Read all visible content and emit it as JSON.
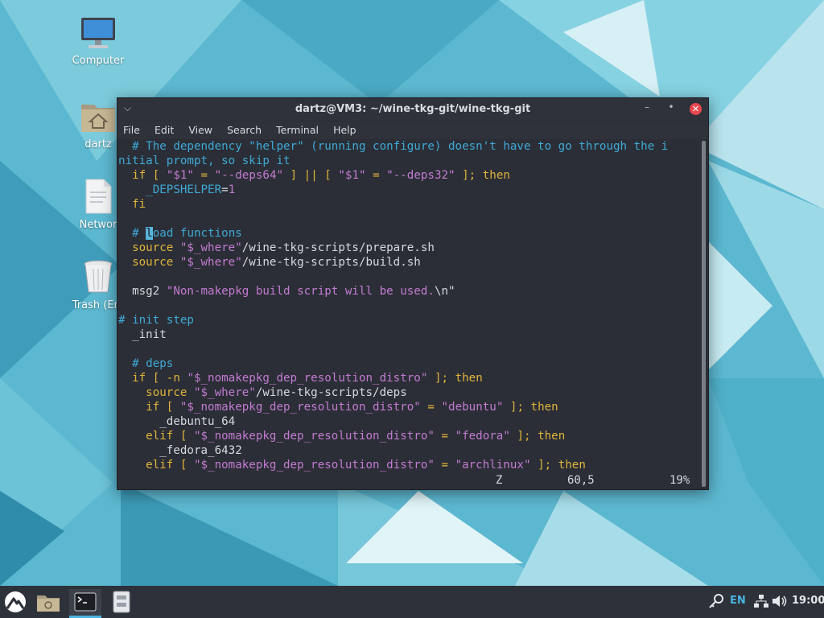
{
  "desktop_icons": [
    {
      "name": "Computer"
    },
    {
      "name": "dartz"
    },
    {
      "name": "Networ"
    },
    {
      "name": "Trash (Em"
    }
  ],
  "window": {
    "title": "dartz@VM3: ~/wine-tkg-git/wine-tkg-git",
    "menu_icon": "chevron-down-icon",
    "menu": [
      "File",
      "Edit",
      "View",
      "Search",
      "Terminal",
      "Help"
    ]
  },
  "code": {
    "l01a": "# The dependency \"helper\" (running configure) doesn't have to go through the i",
    "l01b": "nitial prompt, so skip it",
    "l02_kw1": "if",
    "l02_p1": " [ ",
    "l02_s1": "\"$1\"",
    "l02_p2": " = ",
    "l02_s2": "\"--deps64\"",
    "l02_p3": " ] || [ ",
    "l02_s3": "\"$1\"",
    "l02_p4": " = ",
    "l02_s4": "\"--deps32\"",
    "l02_p5": " ]; ",
    "l02_kw2": "then",
    "l03_var": "_DEPSHELPER",
    "l03_eq": "=",
    "l03_val": "1",
    "l04": "fi",
    "l05_hash": "# ",
    "l05_cur": "l",
    "l05_rest": "oad functions",
    "l06_a": "source ",
    "l06_s": "\"$_where\"",
    "l06_b": "/wine-tkg-scripts/prepare.sh",
    "l07_a": "source ",
    "l07_s": "\"$_where\"",
    "l07_b": "/wine-tkg-scripts/build.sh",
    "l08_a": "msg2 ",
    "l08_s": "\"Non-makepkg build script will be used.",
    "l08_e": "\\n\"",
    "l09": "# init step",
    "l10": "_init",
    "l11": "# deps",
    "l12_kw": "if",
    "l12_p": " [ -n ",
    "l12_s": "\"$_nomakepkg_dep_resolution_distro\"",
    "l12_p2": " ]; ",
    "l12_kw2": "then",
    "l13_a": "source ",
    "l13_s": "\"$_where\"",
    "l13_b": "/wine-tkg-scripts/deps",
    "l14_kw": "if",
    "l14_p": " [ ",
    "l14_s": "\"$_nomakepkg_dep_resolution_distro\"",
    "l14_p2": " = ",
    "l14_s2": "\"debuntu\"",
    "l14_p3": " ]; ",
    "l14_kw2": "then",
    "l15": "_debuntu_64",
    "l16_kw": "elif",
    "l16_p": " [ ",
    "l16_s": "\"$_nomakepkg_dep_resolution_distro\"",
    "l16_p2": " = ",
    "l16_s2": "\"fedora\"",
    "l16_p3": " ]; ",
    "l16_kw2": "then",
    "l17": "_fedora_6432",
    "l18_kw": "elif",
    "l18_p": " [ ",
    "l18_s": "\"$_nomakepkg_dep_resolution_distro\"",
    "l18_p2": " = ",
    "l18_s2": "\"archlinux\"",
    "l18_p3": " ]; ",
    "l18_kw2": "then"
  },
  "status": {
    "mode": "Z",
    "position": "60,5",
    "percent": "19%"
  },
  "taskbar": {
    "language": "EN",
    "clock": "19:00"
  },
  "colors": {
    "comment": "#3fa9d6",
    "keyword": "#e0b43c",
    "string": "#c37bd2",
    "close": "#e8474e"
  }
}
